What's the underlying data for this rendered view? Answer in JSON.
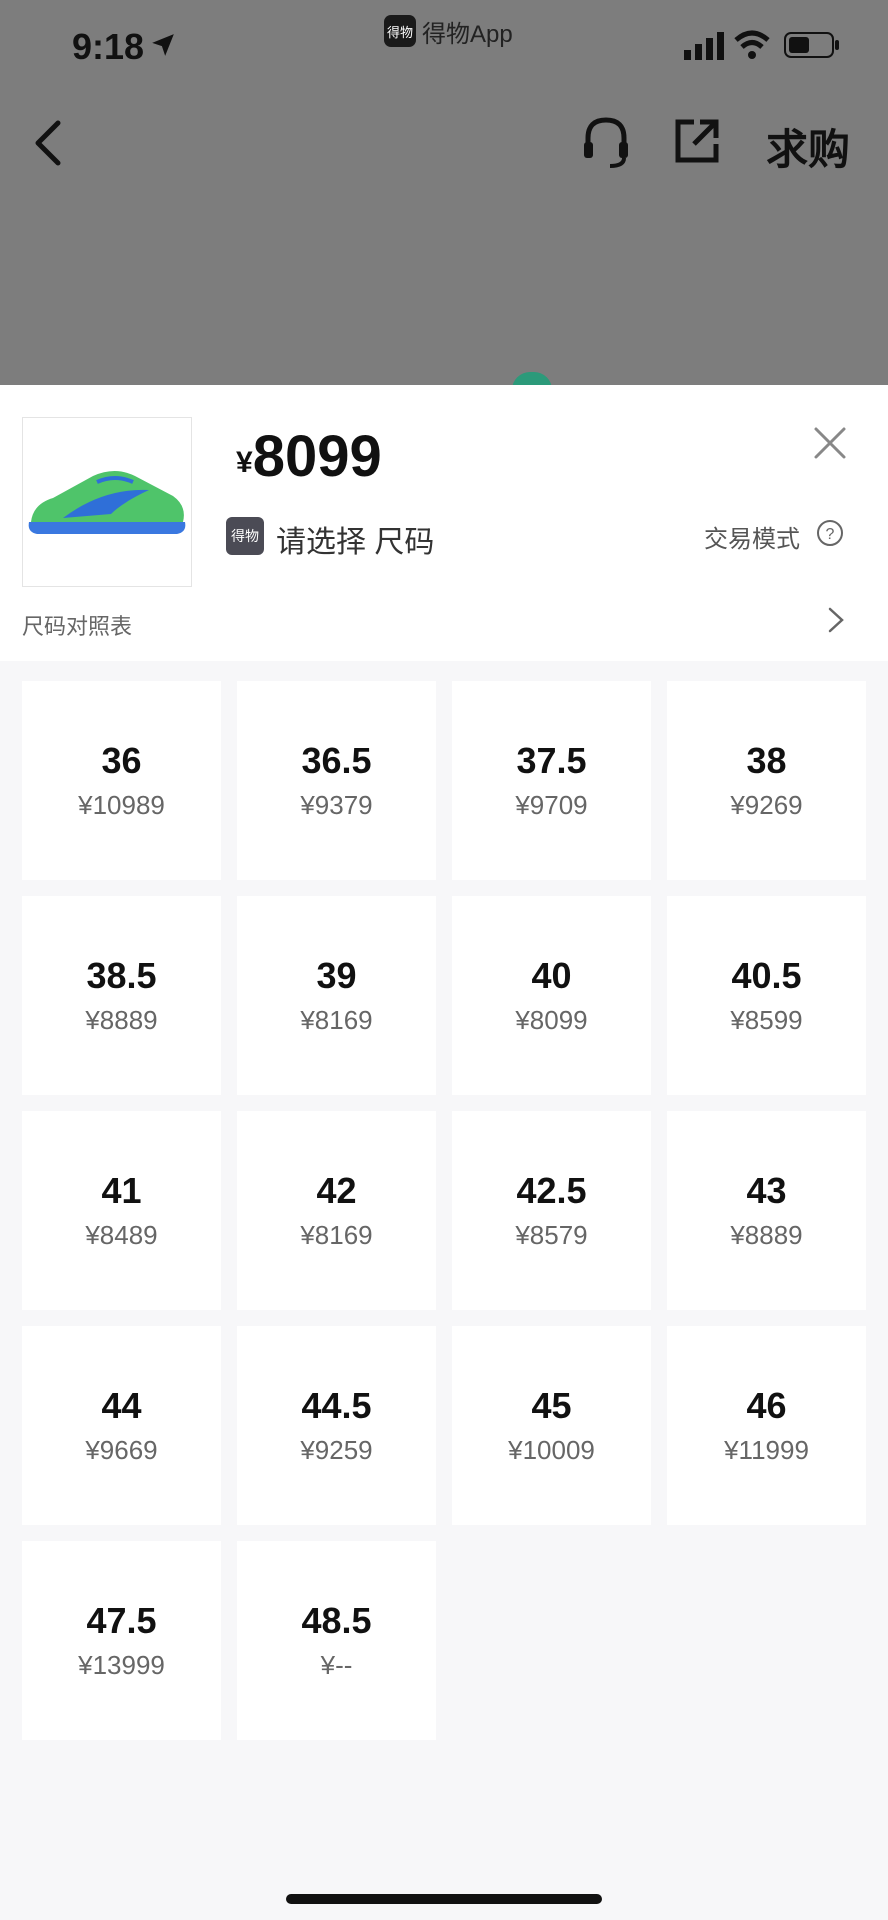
{
  "status_bar": {
    "time": "9:18",
    "app_badge": "得物App",
    "app_logo_text": "得物"
  },
  "nav": {
    "request_label": "求购"
  },
  "product": {
    "currency": "¥",
    "price": "8099",
    "badge_text": "得物",
    "select_prompt": "请选择 尺码",
    "trade_mode": "交易模式",
    "size_chart": "尺码对照表",
    "thumb_colors": {
      "shoe": "#4fc46a",
      "swoosh": "#2f6fd8",
      "sole": "#3a78e0"
    }
  },
  "sizes": [
    {
      "size": "36",
      "price": "¥10989"
    },
    {
      "size": "36.5",
      "price": "¥9379"
    },
    {
      "size": "37.5",
      "price": "¥9709"
    },
    {
      "size": "38",
      "price": "¥9269"
    },
    {
      "size": "38.5",
      "price": "¥8889"
    },
    {
      "size": "39",
      "price": "¥8169"
    },
    {
      "size": "40",
      "price": "¥8099"
    },
    {
      "size": "40.5",
      "price": "¥8599"
    },
    {
      "size": "41",
      "price": "¥8489"
    },
    {
      "size": "42",
      "price": "¥8169"
    },
    {
      "size": "42.5",
      "price": "¥8579"
    },
    {
      "size": "43",
      "price": "¥8889"
    },
    {
      "size": "44",
      "price": "¥9669"
    },
    {
      "size": "44.5",
      "price": "¥9259"
    },
    {
      "size": "45",
      "price": "¥10009"
    },
    {
      "size": "46",
      "price": "¥11999"
    },
    {
      "size": "47.5",
      "price": "¥13999"
    },
    {
      "size": "48.5",
      "price": "¥--"
    }
  ]
}
